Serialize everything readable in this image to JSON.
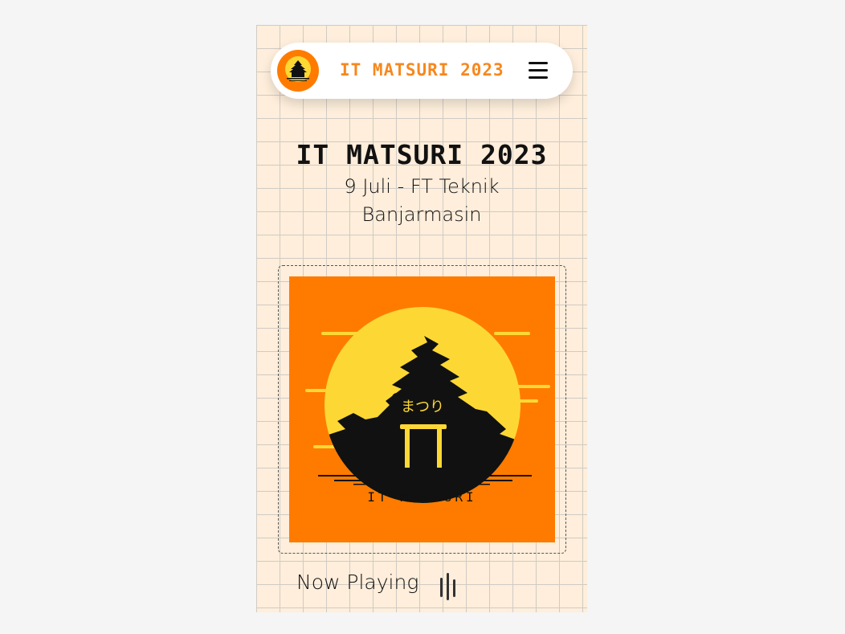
{
  "navbar": {
    "brand": "IT MATSURI 2023",
    "logo_icon": "pagoda-logo-icon",
    "menu_icon": "hamburger-menu-icon"
  },
  "hero": {
    "title": "IT MATSURI 2023",
    "subtitle": "9 Juli - FT Teknik Banjarmasin"
  },
  "poster": {
    "script_text": "まつり",
    "caption": "IT MATSURI"
  },
  "player": {
    "label": "Now Playing",
    "icon": "audio-bars-icon"
  },
  "colors": {
    "background": "#feeedb",
    "accent_orange": "#ff7b00",
    "sun_yellow": "#fdd835",
    "brand_text": "#f7871e",
    "dark": "#111111"
  }
}
